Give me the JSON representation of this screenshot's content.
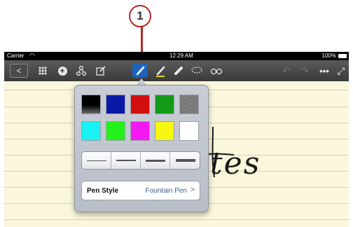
{
  "callout": {
    "number": "1"
  },
  "status_bar": {
    "carrier": "Carrier",
    "time": "12:29 AM",
    "battery": "100%"
  },
  "toolbar": {
    "back_icon": "chevron-left-icon",
    "items": [
      "back",
      "grid",
      "add",
      "share",
      "edit",
      "pen",
      "highlighter",
      "eraser",
      "lasso",
      "view",
      "undo",
      "redo",
      "more",
      "fullscreen"
    ]
  },
  "note": {
    "handwriting": "tes"
  },
  "pen_popover": {
    "colors_row1": [
      "#000000",
      "#0a1aa6",
      "#d20f0f",
      "#129a18",
      "#7b7b7b"
    ],
    "colors_row2": [
      "#19f1f5",
      "#22f21a",
      "#f21af0",
      "#f7f712",
      "#ffffff"
    ],
    "selected_thickness_index": 1,
    "pen_style_label": "Pen Style",
    "pen_style_value": "Fountain Pen"
  },
  "accent_colors": {
    "callout": "#b22a22",
    "selected": "#1f63c4",
    "highlighter_underline": "#e7d21b"
  }
}
